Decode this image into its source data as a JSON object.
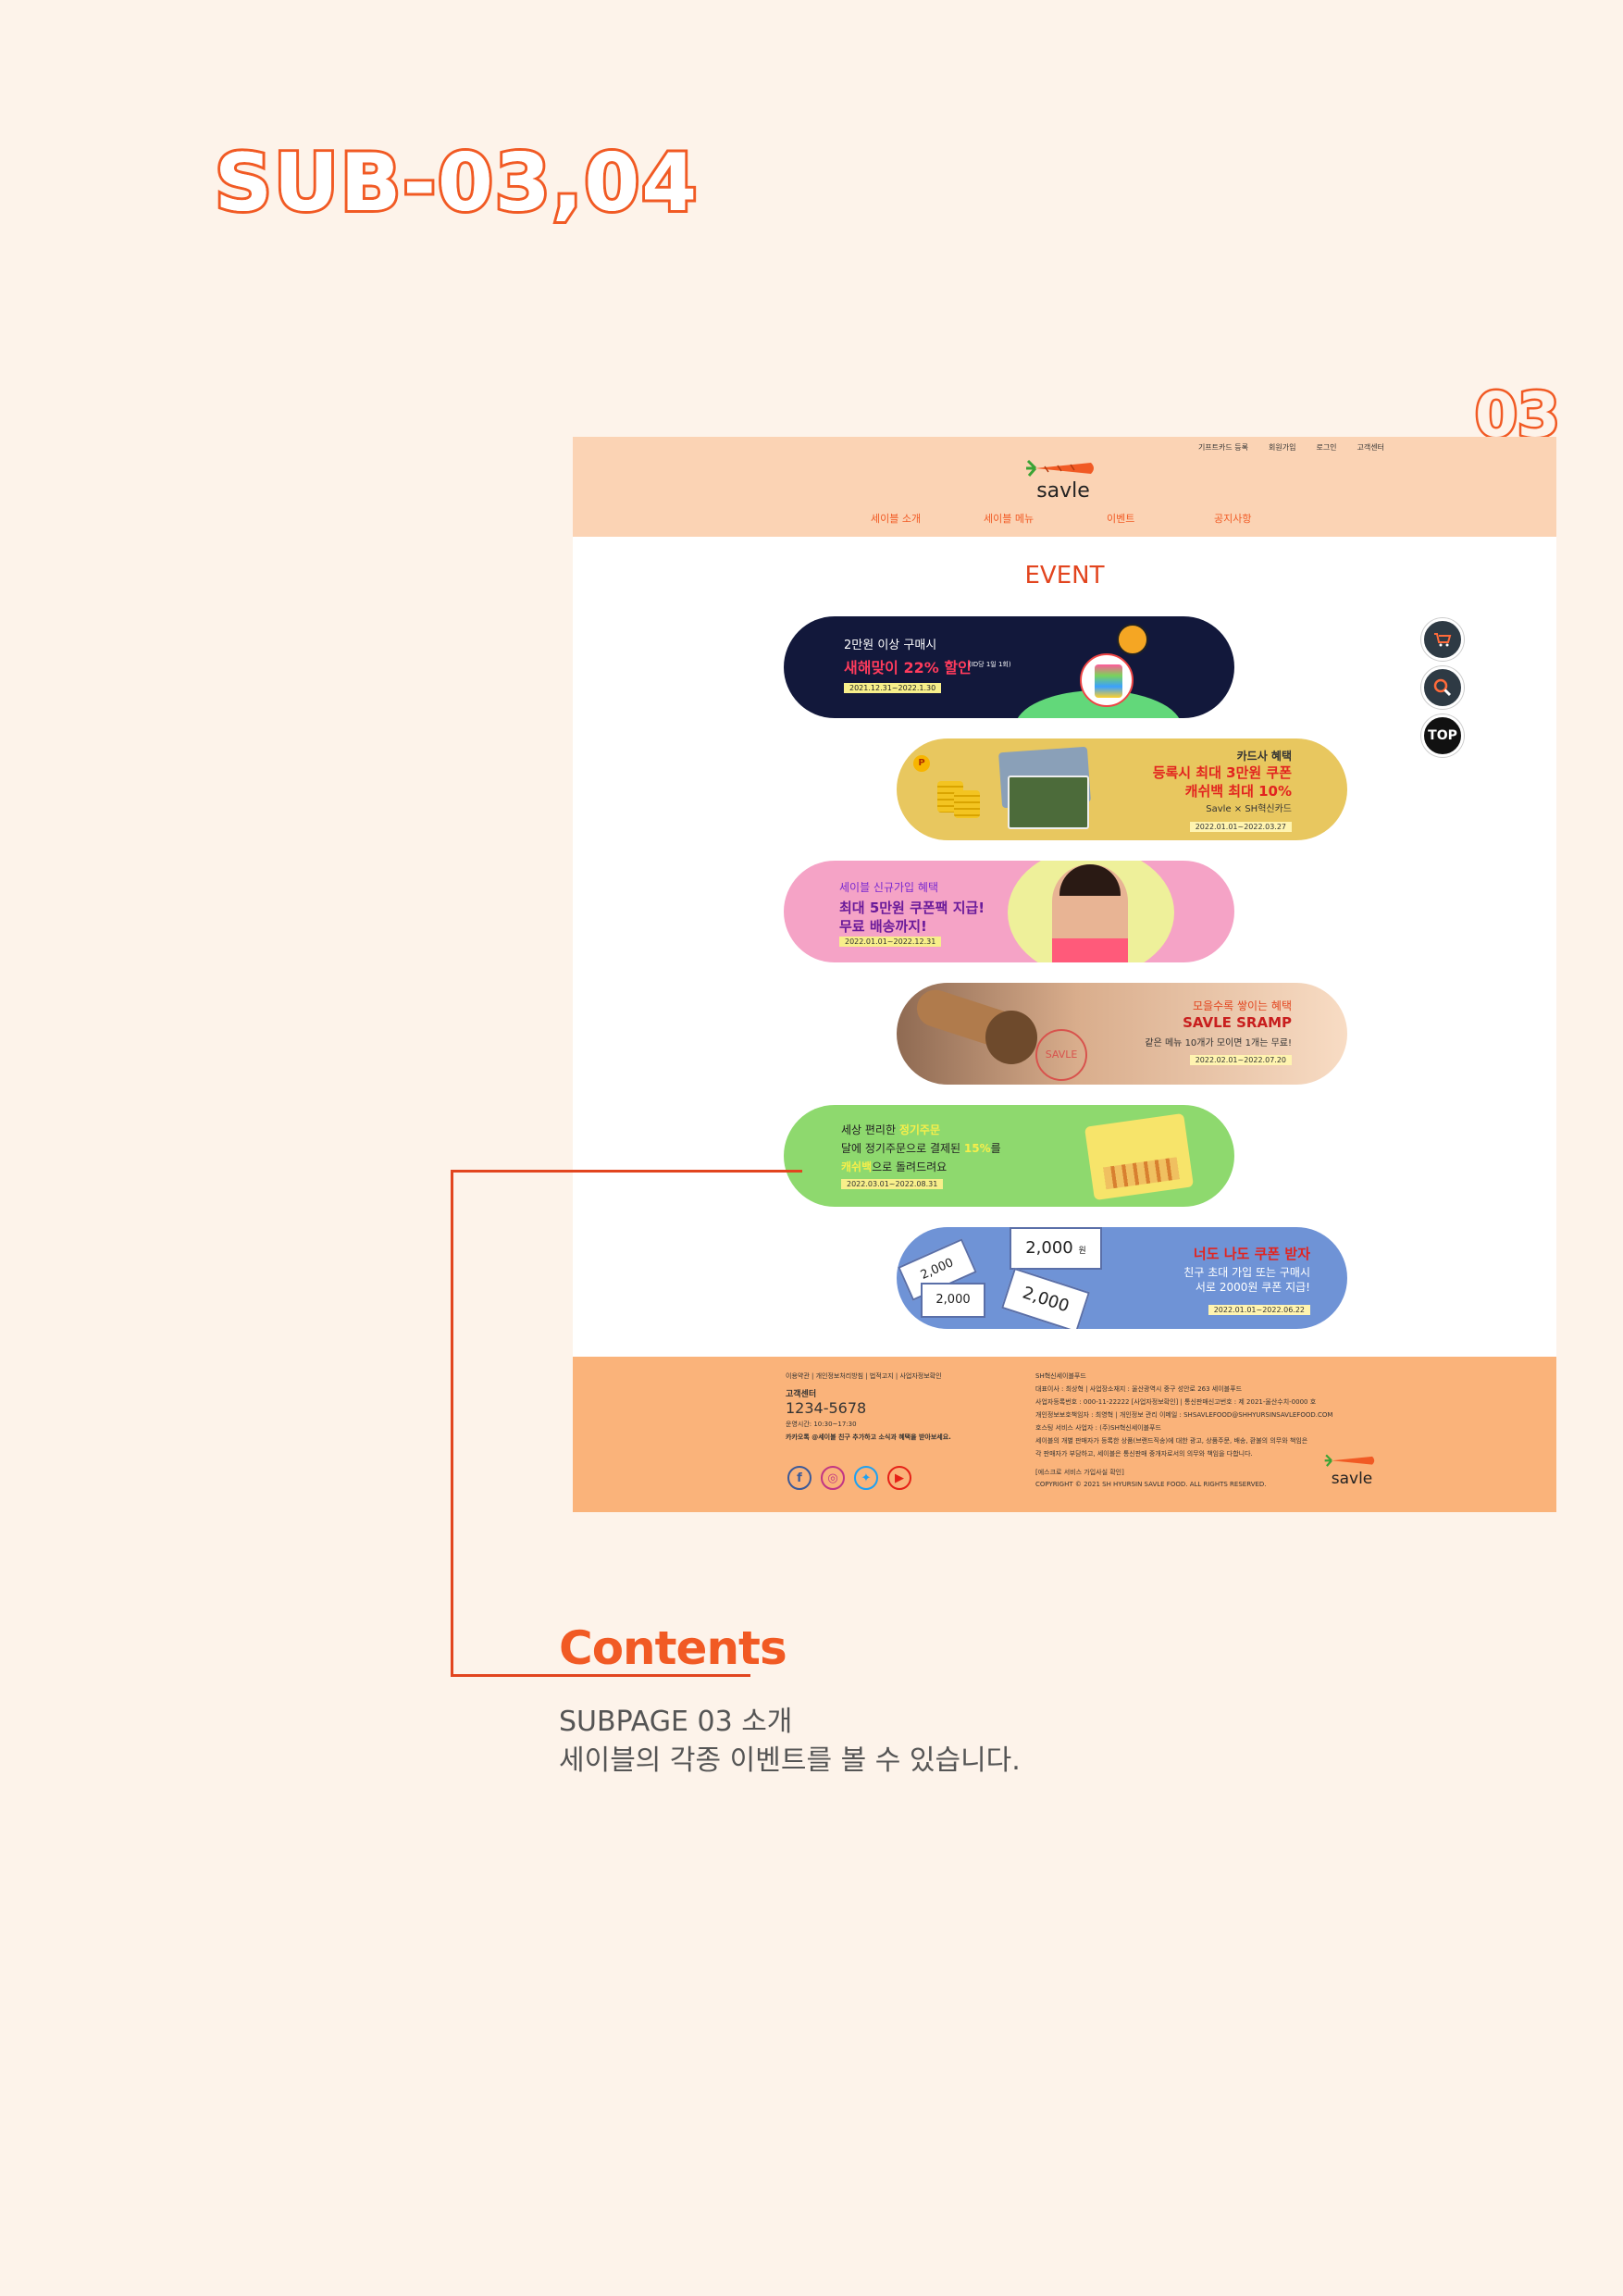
{
  "page": {
    "title": "SUB-03,04",
    "number": "03"
  },
  "mockup": {
    "util_links": [
      "기프트카드 등록",
      "회원가입",
      "로그인",
      "고객센터"
    ],
    "logo_text": "savle",
    "nav": [
      "세이블 소개",
      "세이블 메뉴",
      "이벤트",
      "공지사항"
    ],
    "event_title": "EVENT",
    "banners": [
      {
        "line1": "2만원 이상 구매시",
        "line2": "새해맞이 22% 할인",
        "note": "(ID당 1일 1회)",
        "date": "2021.12.31~2022.1.30",
        "bg": "#12183b"
      },
      {
        "line1": "카드사 혜택",
        "line2": "등록시 최대 3만원 쿠폰",
        "line3": "캐쉬백 최대 10%",
        "line4": "Savle × SH혁신카드",
        "date": "2022.01.01~2022.03.27",
        "bg": "#e8c75f"
      },
      {
        "line1": "세이블 신규가입 혜택",
        "line2": "최대 5만원 쿠폰팩 지급!",
        "line3": "무료 배송까지!",
        "date": "2022.01.01~2022.12.31",
        "bg": "#f5a3c6"
      },
      {
        "line1": "모을수록 쌓이는 혜택",
        "line2": "SAVLE SRAMP",
        "line3": "같은 메뉴 10개가 모이면 1개는 무료!",
        "stamp": "SAVLE",
        "date": "2022.02.01~2022.07.20",
        "bg": "#f4c9a8"
      },
      {
        "line1a": "세상 편리한 ",
        "line1b": "정기주문",
        "line2a": "달에 정기주문으로 결제된 ",
        "line2b": "15%",
        "line2c": "를",
        "line3a": "캐쉬백",
        "line3b": "으로 돌려드려요",
        "date": "2022.03.01~2022.08.31",
        "bg": "#8ed96e"
      },
      {
        "coupon": "2,000",
        "unit": "원",
        "line1": "너도 나도 쿠폰 받자",
        "line2": "친구 초대 가입 또는 구매시",
        "line3": "서로 2000원 쿠폰 지급!",
        "date": "2022.01.01~2022.06.22",
        "bg": "#6f93d6"
      }
    ],
    "quick_buttons": {
      "cart_icon": "cart-icon",
      "search_icon": "search-icon",
      "top_label": "TOP"
    },
    "footer": {
      "links": "이용약관 | 개인정보처리방침 | 법적고지 | 사업자정보확인",
      "cs_label": "고객센터",
      "cs_phone": "1234-5678",
      "cs_hours": "운영시간: 10:30~17:30",
      "kakao": "카카오톡 @세이블 친구 추가하고 소식과 혜택을 받아보세요.",
      "company_lines": [
        "SH혁신세이블푸드",
        "대표이사 : 최상혁 | 사업장소재지 : 울산광역시 중구 성안로 263 세이블푸드",
        "사업자등록번호 : 000-11-22222 [사업자정보확인] | 통신판매신고번호 : 제 2021-울산수치-0000 호",
        "개인정보보호책임자 : 최영혁 | 개인정보 관리 이메일 : SHSAVLEFOOD@SHHYURSINSAVLEFOOD.COM",
        "호스팅 서비스 사업자 : (주)SH혁신세이블푸드",
        "세이블의 개별 판매자가 등록한 상품(브랜드직송)에 대한 광고, 상품주문, 배송, 환불의 의무와 책임은",
        "각 판매자가 부담하고, 세이블은 통신판매 중개자로서의 의무와 책임을 다합니다."
      ],
      "escrow": "[에스크로 서비스 가입사실 확인]",
      "copyright": "COPYRIGHT © 2021 SH HYURSIN SAVLE FOOD. ALL RIGHTS RESERVED.",
      "sns": [
        "f",
        "ig",
        "tw",
        "yt"
      ],
      "logo_text": "savle"
    }
  },
  "contents": {
    "title": "Contents",
    "desc_line1": "SUBPAGE 03 소개",
    "desc_line2": "세이블의 각종 이벤트를 볼 수 있습니다."
  },
  "colors": {
    "accent": "#f15a24",
    "background": "#fdf3ea",
    "header": "#fbd3b4",
    "footer": "#fab37a"
  }
}
